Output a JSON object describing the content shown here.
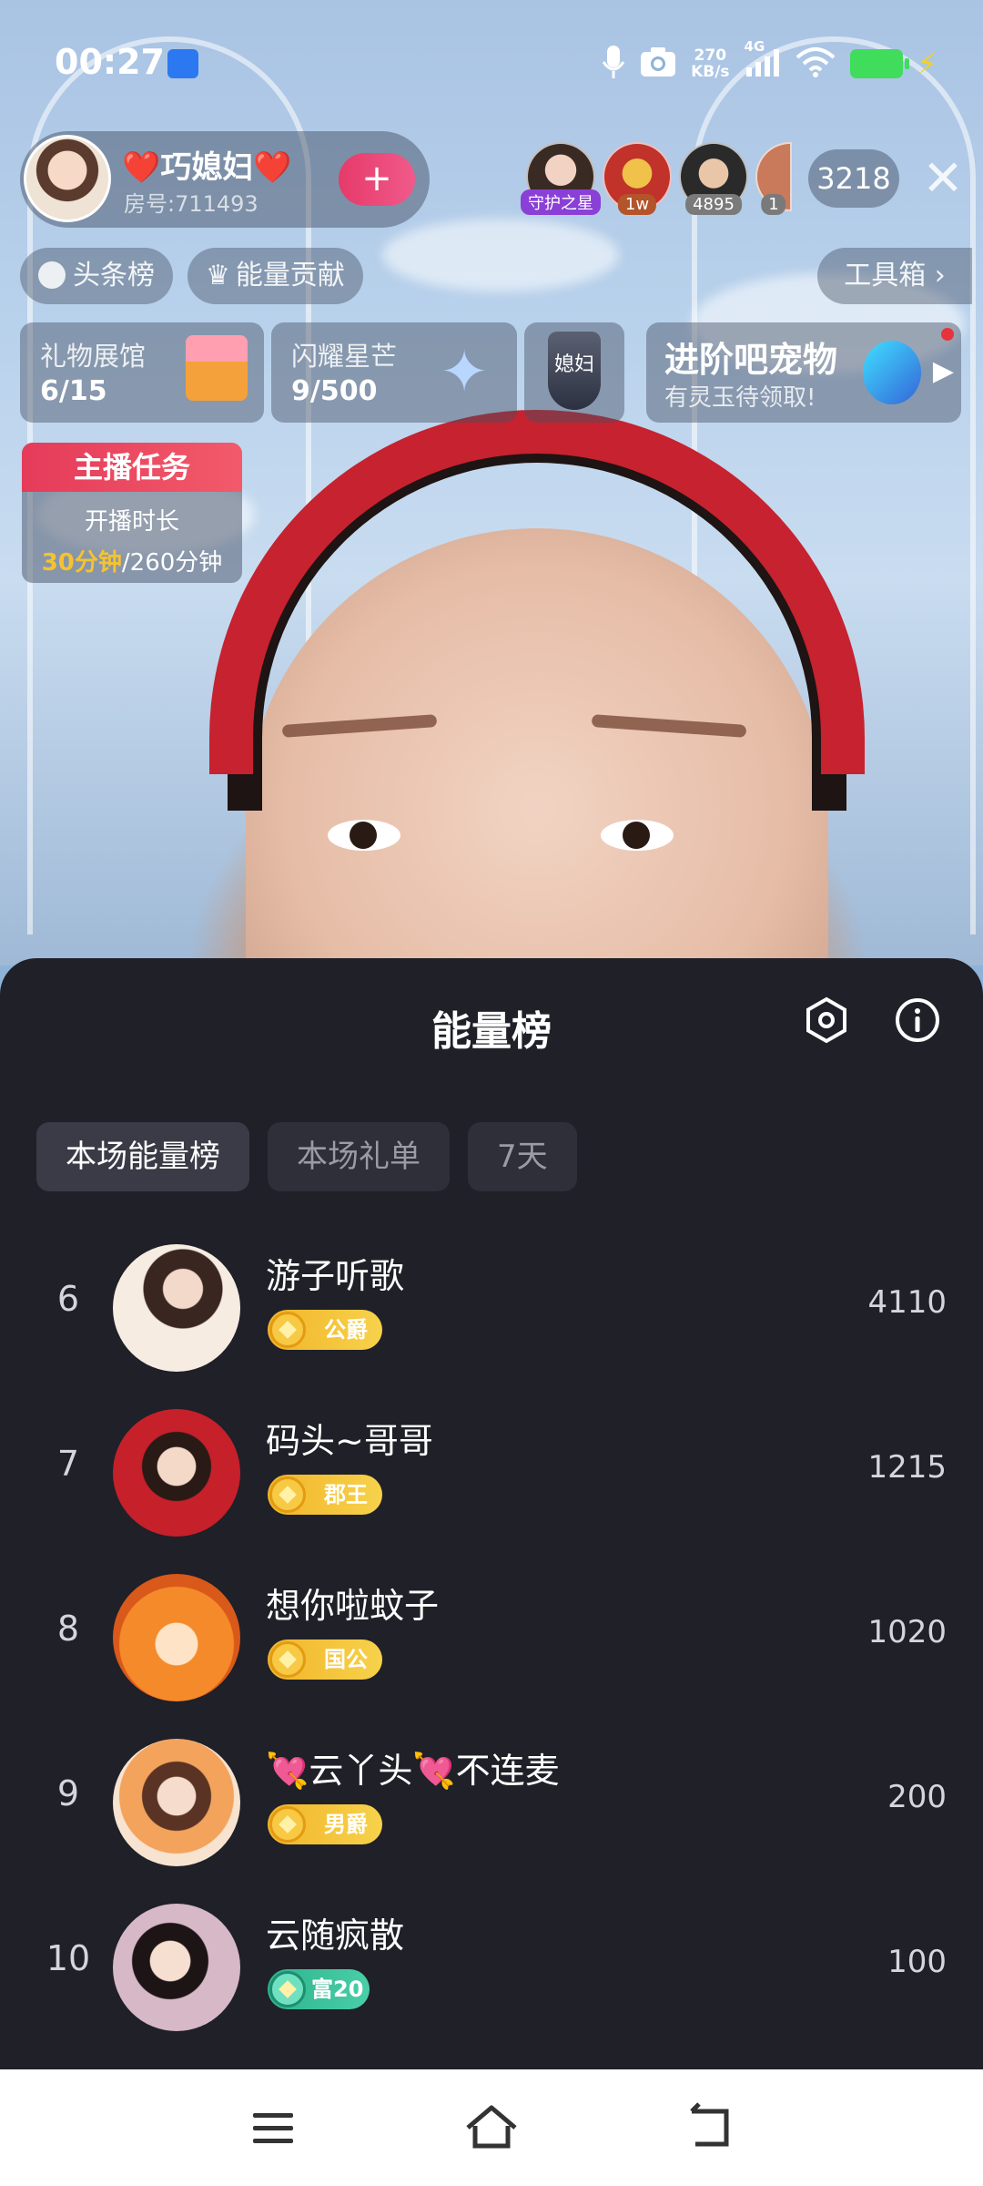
{
  "status_bar": {
    "time": "00:27",
    "speed_value": "270",
    "speed_unit": "KB/s",
    "network": "4G"
  },
  "host": {
    "name": "❤️巧媳妇❤️",
    "room": "房号:711493",
    "follow_symbol": "+"
  },
  "viewers": [
    {
      "badge": "守护之星",
      "badge_color": "#8a3fd6"
    },
    {
      "badge": "1w",
      "badge_color": "#b3542a"
    },
    {
      "badge": "4895",
      "badge_color": "#7a7a7a"
    },
    {
      "badge": "1",
      "badge_color": "#7a7a7a"
    }
  ],
  "viewer_count": "3218",
  "chips": {
    "headline": "头条榜",
    "energy": "能量贡献",
    "tools": "工具箱"
  },
  "panels": {
    "gift_title": "礼物展馆",
    "gift_value": "6/15",
    "star_title": "闪耀星芒",
    "star_value": "9/500",
    "shield_label": "媳妇",
    "pet_title": "进阶吧宠物",
    "pet_sub": "有灵玉待领取!"
  },
  "task": {
    "header": "主播任务",
    "line1": "开播时长",
    "done": "30分钟",
    "total": "/260分钟"
  },
  "sheet": {
    "title": "能量榜",
    "tabs": [
      "本场能量榜",
      "本场礼单",
      "7天"
    ]
  },
  "ranking": [
    {
      "rank": "6",
      "name": "游子听歌",
      "badge": "公爵",
      "score": "4110",
      "badge_type": "gold"
    },
    {
      "rank": "7",
      "name": "码头~哥哥",
      "badge": "郡王",
      "score": "1215",
      "badge_type": "gold"
    },
    {
      "rank": "8",
      "name": "想你啦蚊子",
      "badge": "国公",
      "score": "1020",
      "badge_type": "gold"
    },
    {
      "rank": "9",
      "name": "💘云丫头💘不连麦",
      "badge": "男爵",
      "score": "200",
      "badge_type": "gold"
    },
    {
      "rank": "10",
      "name": "云随疯散",
      "badge": "富20",
      "score": "100",
      "badge_type": "green"
    }
  ],
  "colors": {
    "sheet_bg": "#1f2028",
    "badge_gold": "#f1b52a",
    "badge_green": "#2fb38f",
    "task_header": "#e53b5a",
    "task_highlight": "#f5c330"
  },
  "icons": {
    "nav": [
      "menu-icon",
      "home-icon",
      "back-icon"
    ]
  }
}
